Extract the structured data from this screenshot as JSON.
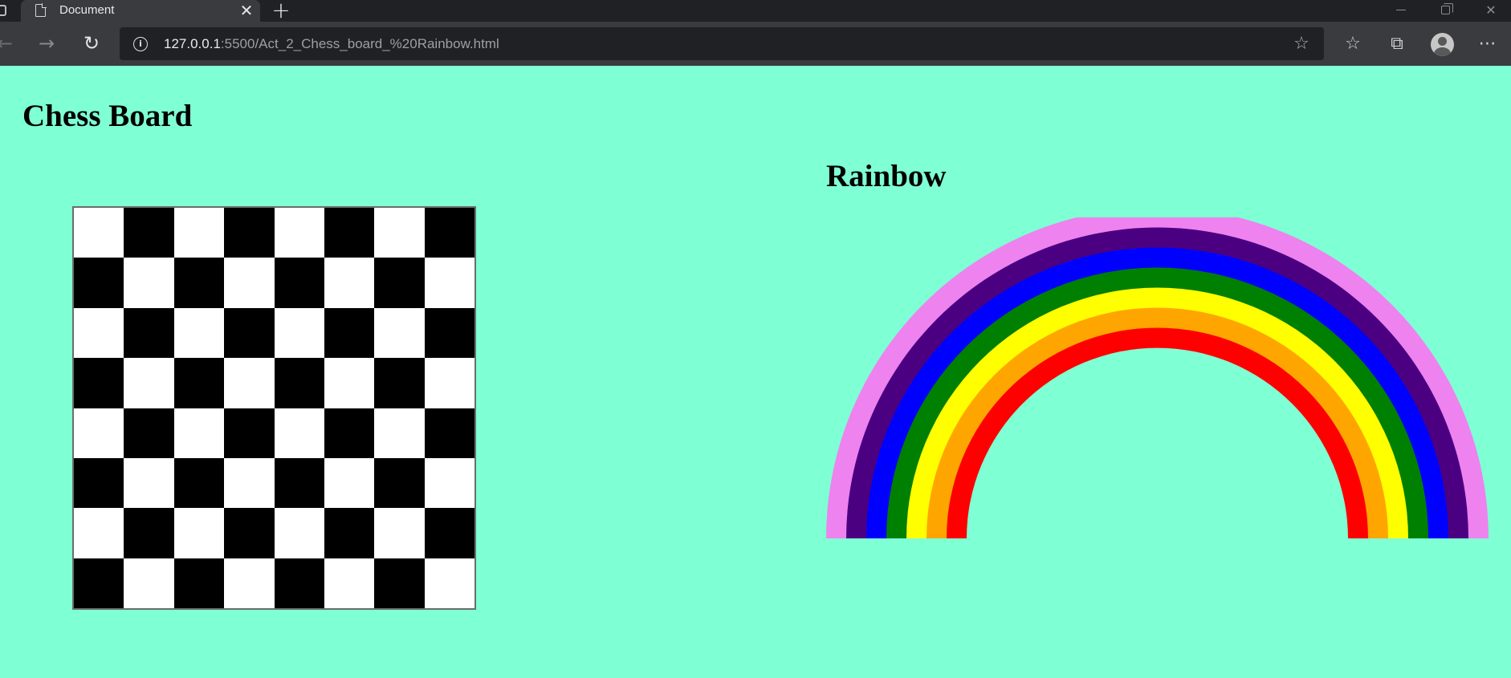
{
  "browser": {
    "tab_title": "Document",
    "tab_close_glyph": "✕",
    "new_tab_glyph": "+",
    "url_host": "127.0.0.1",
    "url_rest": ":5500/Act_2_Chess_board_%20Rainbow.html",
    "icons": [
      "page-icon",
      "close-icon",
      "plus-icon",
      "back-icon",
      "forward-icon",
      "refresh-icon",
      "info-icon",
      "add-favorite-icon",
      "favorites-icon",
      "collections-icon",
      "profile-avatar",
      "more-icon"
    ]
  },
  "page": {
    "background": "#7fffd4",
    "chess_heading": "Chess Board",
    "rainbow_heading": "Rainbow"
  },
  "chess_board": {
    "rows": 8,
    "cols": 8,
    "first_square": "white",
    "colors": {
      "white": "#ffffff",
      "black": "#000000"
    }
  },
  "rainbow": {
    "bands_outer_to_inner": [
      "#ee82ee",
      "#4b0082",
      "#0000ff",
      "#008000",
      "#ffff00",
      "#ffa500",
      "#ff0000"
    ],
    "center_fill": "#7fffd4"
  }
}
